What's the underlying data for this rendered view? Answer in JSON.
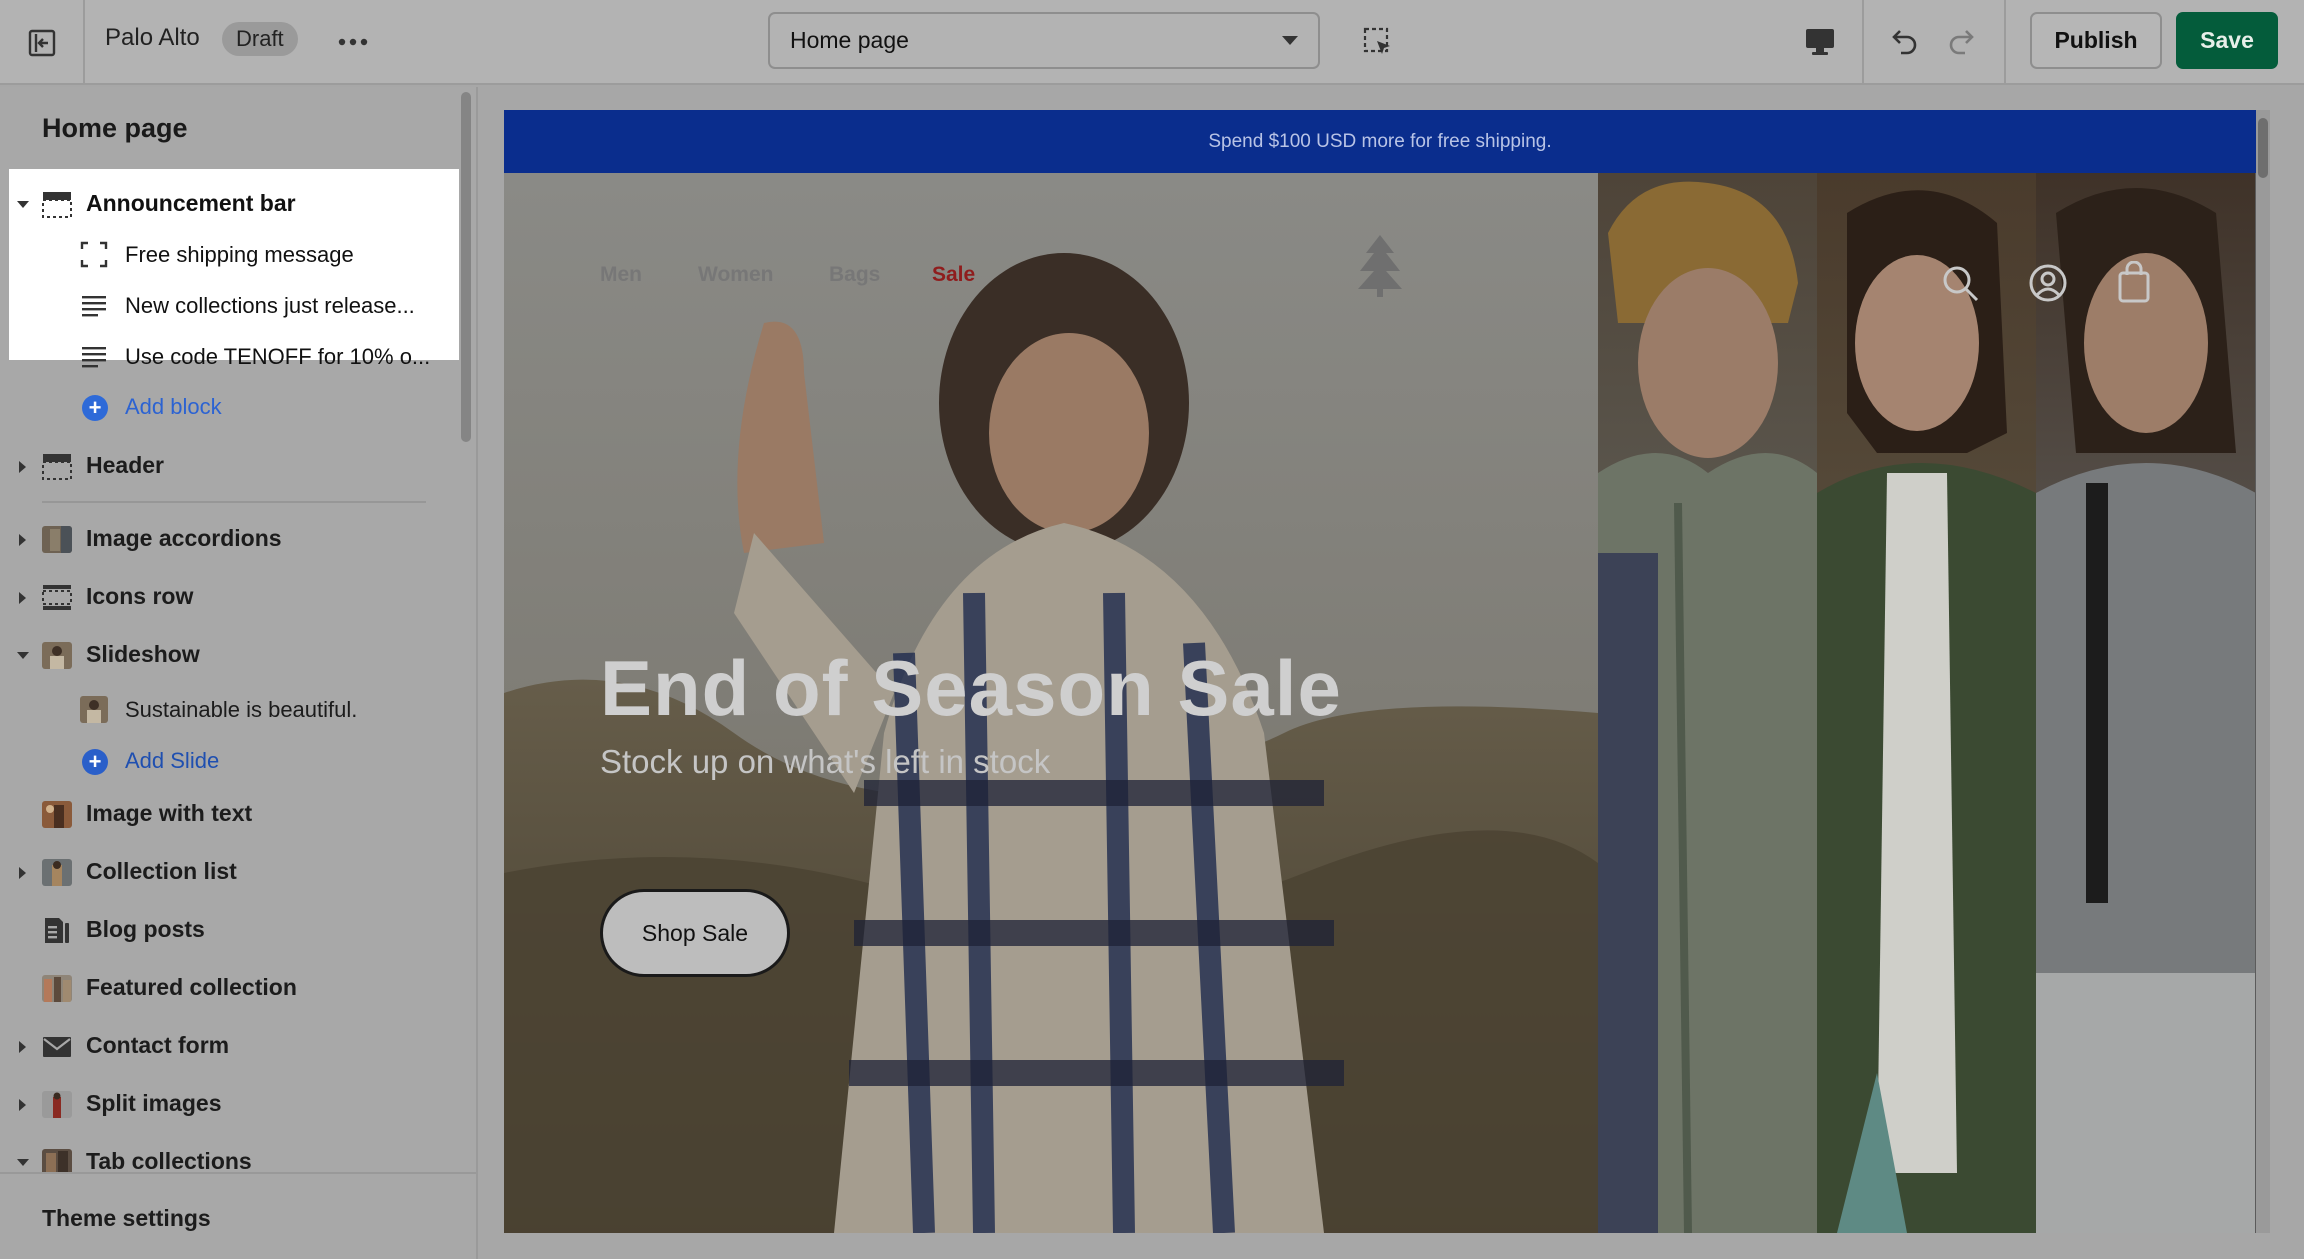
{
  "topbar": {
    "store_name": "Palo Alto",
    "status_badge": "Draft",
    "page_select": "Home page",
    "publish_label": "Publish",
    "save_label": "Save"
  },
  "sidebar": {
    "title": "Home page",
    "sections": [
      {
        "label": "Announcement bar",
        "expanded": true
      },
      {
        "label": "Header",
        "expanded": false
      },
      {
        "label": "Image accordions",
        "expanded": false
      },
      {
        "label": "Icons row",
        "expanded": false
      },
      {
        "label": "Slideshow",
        "expanded": true
      },
      {
        "label": "Image with text",
        "expanded": false
      },
      {
        "label": "Collection list",
        "expanded": false
      },
      {
        "label": "Blog posts",
        "expanded": false
      },
      {
        "label": "Featured collection",
        "expanded": false
      },
      {
        "label": "Contact form",
        "expanded": false
      },
      {
        "label": "Split images",
        "expanded": false
      },
      {
        "label": "Tab collections",
        "expanded": true
      }
    ],
    "announcement_blocks": [
      {
        "label": "Free shipping message",
        "icon": "dashed-frame-icon"
      },
      {
        "label": "New collections just release...",
        "icon": "text-lines-icon"
      },
      {
        "label": "Use code TENOFF for 10% o...",
        "icon": "text-lines-icon"
      }
    ],
    "add_block_label": "Add block",
    "slideshow_blocks": [
      {
        "label": "Sustainable is beautiful.",
        "icon": "image-thumbnail"
      }
    ],
    "add_slide_label": "Add Slide",
    "theme_settings_label": "Theme settings"
  },
  "preview": {
    "announcement_text": "Spend $100 USD more for free shipping.",
    "nav": [
      "Men",
      "Women",
      "Bags",
      "Sale"
    ],
    "hero_title": "End of Season Sale",
    "hero_subtitle": "Stock up on what's left in stock",
    "hero_button": "Shop Sale"
  },
  "colors": {
    "save_button": "#045c3b",
    "announcement_bar": "#0a2d8d",
    "link_blue": "#2c63d2",
    "sale_red": "#8f1d1d"
  }
}
